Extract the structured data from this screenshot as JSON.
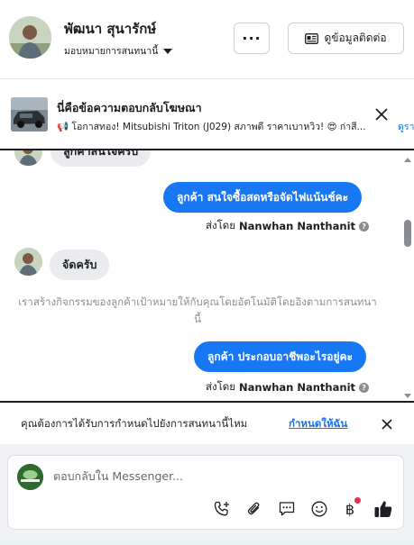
{
  "header": {
    "name": "พัฒนา สุนารักษ์",
    "assign_label": "มอบหมายการสนทนานี้",
    "more_label": "···",
    "contact_label": "ดูข้อมูลติดต่อ"
  },
  "ad_reply": {
    "title": "นี่คือข้อความตอบกลับโฆษณา",
    "text": "📢 โอกาสทอง! Mitsubishi Triton (J029) สภาพดี ราคาเบาหวิว! 😍 ก่าสี...",
    "link": "ดูรายละเอียด"
  },
  "chat": {
    "messages": [
      {
        "direction": "in",
        "text": "ลูกค้าสนใจครับ"
      },
      {
        "direction": "out",
        "text": "ลูกค้า สนใจซื้อสดหรือจัดไฟแน้นช์คะ"
      },
      {
        "direction": "sent_by",
        "prefix": "ส่งโดย",
        "name": "Nanwhan Nanthanit",
        "help": "?"
      },
      {
        "direction": "in",
        "text": "จัดครับ"
      },
      {
        "direction": "system",
        "text": "เราสร้างกิจกรรมของลูกค้าเป้าหมายให้กับคุณโดยอัตโนมัติโดยอิงตามการสนทนานี้"
      },
      {
        "direction": "out",
        "text": "ลูกค้า ประกอบอาชีพอะไรอยู่คะ"
      },
      {
        "direction": "sent_by",
        "prefix": "ส่งโดย",
        "name": "Nanwhan Nanthanit",
        "help": "?"
      }
    ]
  },
  "assign_prompt": {
    "text": "คุณต้องการได้รับการกำหนดไปยังการสนทนานี้ไหม",
    "link": "กำหนดให้ฉัน"
  },
  "composer": {
    "placeholder": "ตอบกลับใน Messenger...",
    "tools": [
      "phone-plus-icon",
      "paperclip-icon",
      "saved-reply-icon",
      "emoji-icon",
      "baht-payment-icon",
      "like-icon"
    ],
    "baht_symbol": "฿"
  },
  "colors": {
    "accent": "#1877f2",
    "link": "#1a73e8",
    "incoming_bubble": "#eaebee",
    "notification_dot": "#f02849"
  }
}
